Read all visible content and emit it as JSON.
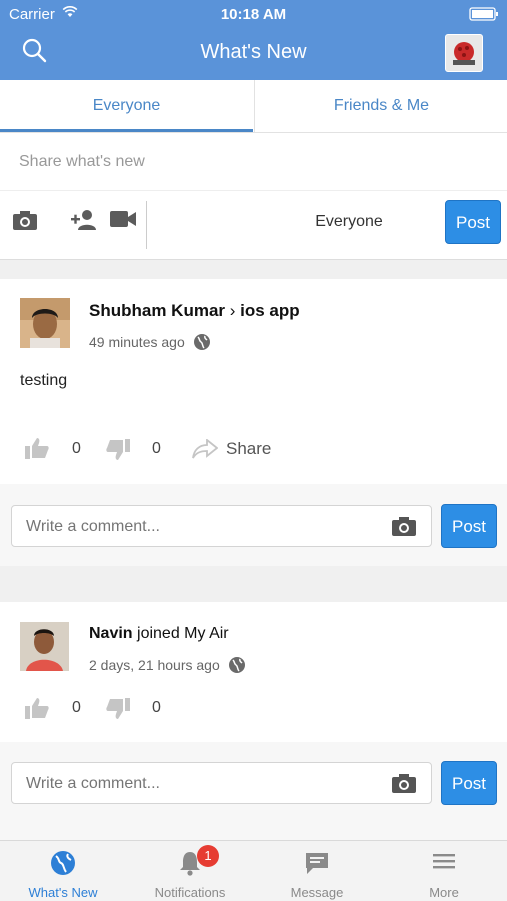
{
  "status_bar": {
    "carrier": "Carrier",
    "time": "10:18 AM"
  },
  "nav": {
    "title": "What's New"
  },
  "tabs": [
    {
      "label": "Everyone"
    },
    {
      "label": "Friends & Me"
    }
  ],
  "composer": {
    "placeholder": "Share what's new",
    "privacy": "Everyone",
    "post_label": "Post"
  },
  "feed": [
    {
      "author": "Shubham Kumar",
      "separator": " › ",
      "target": "ios app",
      "time": "49 minutes ago",
      "text": "testing",
      "likes": "0",
      "dislikes": "0",
      "share_label": "Share",
      "comment_placeholder": "Write a comment...",
      "comment_post_label": "Post"
    },
    {
      "author": "Navin",
      "action": " joined My Air",
      "time": "2 days, 21 hours ago",
      "likes": "0",
      "dislikes": "0",
      "comment_placeholder": "Write a comment...",
      "comment_post_label": "Post"
    }
  ],
  "bottom_nav": [
    {
      "label": "What's New",
      "active": true
    },
    {
      "label": "Notifications",
      "badge": "1"
    },
    {
      "label": "Message"
    },
    {
      "label": "More"
    }
  ],
  "colors": {
    "header": "#5a93d9",
    "accent": "#2d8ee5",
    "badge": "#e63c32"
  }
}
